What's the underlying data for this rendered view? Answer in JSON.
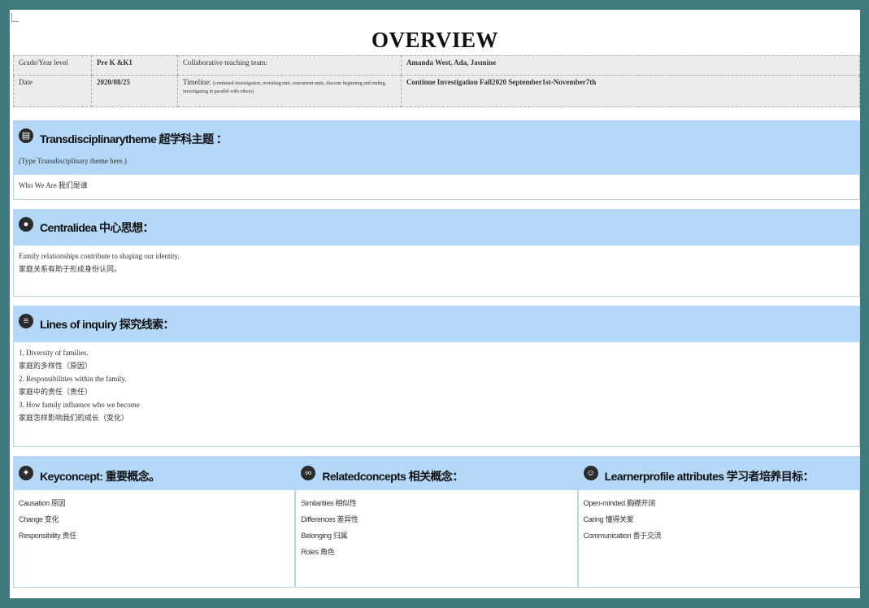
{
  "title": "OVERVIEW",
  "meta": {
    "grade_label": "Grade/Year level",
    "grade_value": "Pre K &K1",
    "collab_label": "Collaborative teaching team:",
    "collab_value": "Amanda West, Ada, Jasmine",
    "date_label": "Date",
    "date_value": "2020/08/25",
    "timeline_label": "Timeline:",
    "timeline_note": "(continued investigation, revisiting unit, concurrent units, discrete beginning and ending, investigating in parallel with others)",
    "timeline_value": "Continue Investigation Fall2020 September1st-November7th"
  },
  "theme": {
    "icon": "book-icon",
    "title": "Transdisciplinarytheme 超学科主题 ：",
    "sub": "(Type Transdisciplinary theme here.)",
    "body": "Who We Are 我们是谁"
  },
  "central": {
    "icon": "lightbulb-icon",
    "title": "Centralidea 中心思想：",
    "line1": "Family relationships contribute to shaping our identity.",
    "line2": "家庭关系有助于形成身份认同。"
  },
  "inquiry": {
    "icon": "list-icon",
    "title": "Lines of inquiry 探究线索：",
    "lines": [
      "1.        Diversity of families.",
      "家庭的多样性（原因）",
      "2.        Responsibilities within the family.",
      "家庭中的责任（责任）",
      "3.        How family influence who we become",
      "家庭怎样影响我们的成长（变化）"
    ]
  },
  "key": {
    "icon": "key-icon",
    "title": "Keyconcept: 重要概念。",
    "items": [
      "Causation 原因",
      "Change 变化",
      "Responsibility 责任"
    ]
  },
  "related": {
    "icon": "link-icon",
    "title": "Relatedconcepts 相关概念：",
    "items": [
      "Similarities 相似性",
      "Differences 差异性",
      "Belonging 归属",
      "Roles 角色"
    ]
  },
  "learner": {
    "icon": "person-icon",
    "title": "Learnerprofile attributes 学习者培养目标：",
    "items": [
      "  Open-minded 胸襟开阔",
      "Caring 懂得关爱",
      "Communication 善于交流"
    ]
  }
}
